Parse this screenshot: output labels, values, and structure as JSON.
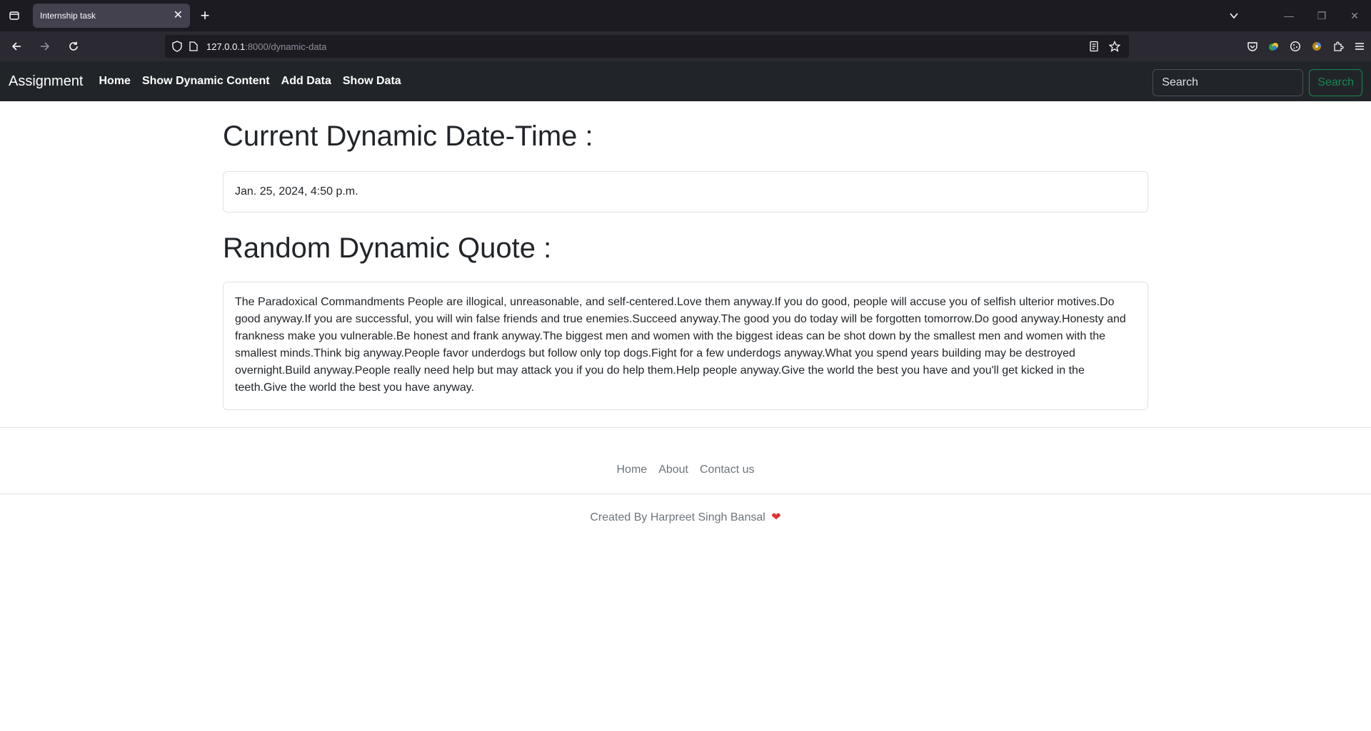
{
  "browser": {
    "tab_title": "Internship task",
    "tab_close": "✕",
    "new_tab": "+",
    "url_host": "127.0.0.1",
    "url_path": ":8000/dynamic-data",
    "win_minimize": "—",
    "win_restore": "❐",
    "win_close": "✕"
  },
  "site_nav": {
    "brand": "Assignment",
    "links": [
      "Home",
      "Show Dynamic Content",
      "Add Data",
      "Show Data"
    ],
    "search_placeholder": "Search",
    "search_button": "Search"
  },
  "main": {
    "date_heading": "Current Dynamic Date-Time :",
    "date_value": "Jan. 25, 2024, 4:50 p.m.",
    "quote_heading": "Random Dynamic Quote :",
    "quote_text": "The Paradoxical Commandments People are illogical, unreasonable, and self-centered.Love them anyway.If you do good, people will accuse you of selfish ulterior motives.Do good anyway.If you are successful, you will win false friends and true enemies.Succeed anyway.The good you do today will be forgotten tomorrow.Do good anyway.Honesty and frankness make you vulnerable.Be honest and frank anyway.The biggest men and women with the biggest ideas can be shot down by the smallest men and women with the smallest minds.Think big anyway.People favor underdogs but follow only top dogs.Fight for a few underdogs anyway.What you spend years building may be destroyed overnight.Build anyway.People really need help but may attack you if you do help them.Help people anyway.Give the world the best you have and you'll get kicked in the teeth.Give the world the best you have anyway."
  },
  "footer": {
    "links": [
      "Home",
      "About",
      "Contact us"
    ],
    "credit": "Created By Harpreet Singh Bansal",
    "heart": "❤"
  }
}
